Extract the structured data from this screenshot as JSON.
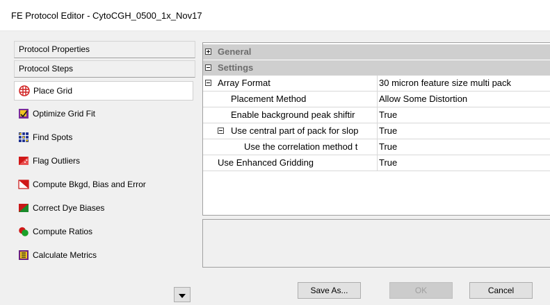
{
  "window": {
    "title": "FE Protocol Editor - CytoCGH_0500_1x_Nov17"
  },
  "left_panel": {
    "protocol_properties_label": "Protocol Properties",
    "protocol_steps_label": "Protocol Steps",
    "steps": [
      {
        "label": "Place Grid",
        "icon": "place-grid-icon"
      },
      {
        "label": "Optimize Grid Fit",
        "icon": "optimize-grid-fit-icon"
      },
      {
        "label": "Find Spots",
        "icon": "find-spots-icon"
      },
      {
        "label": "Flag Outliers",
        "icon": "flag-outliers-icon"
      },
      {
        "label": "Compute Bkgd, Bias and Error",
        "icon": "compute-bkgd-icon"
      },
      {
        "label": "Correct Dye Biases",
        "icon": "correct-dye-biases-icon"
      },
      {
        "label": "Compute Ratios",
        "icon": "compute-ratios-icon"
      },
      {
        "label": "Calculate Metrics",
        "icon": "calculate-metrics-icon"
      }
    ],
    "selected_step": "Place Grid"
  },
  "property_grid": {
    "categories": [
      {
        "label": "General",
        "expanded": false
      },
      {
        "label": "Settings",
        "expanded": true
      }
    ],
    "rows": [
      {
        "name": "Array Format",
        "value": "30 micron feature size multi pack"
      },
      {
        "name": "Placement Method",
        "value": "Allow Some Distortion"
      },
      {
        "name": "Enable background peak shiftir",
        "value": "True"
      },
      {
        "name": "Use central part of pack for slop",
        "value": "True"
      },
      {
        "name": "Use the correlation method t",
        "value": "True"
      },
      {
        "name": "Use Enhanced Gridding",
        "value": "True"
      }
    ]
  },
  "buttons": {
    "save_as": "Save As...",
    "ok": "OK",
    "cancel": "Cancel"
  },
  "colors": {
    "category_bg": "#cfcfcf",
    "category_text": "#6d6d6d",
    "window_bg": "#f0f0f0"
  }
}
